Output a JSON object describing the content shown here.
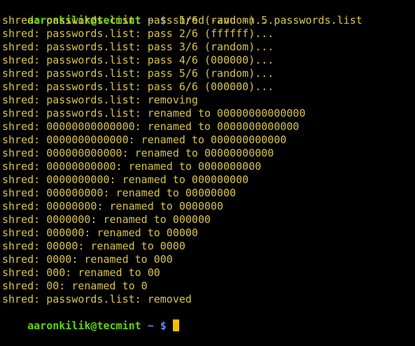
{
  "colors": {
    "background": "#000000",
    "output_text": "#d7c34b",
    "prompt_user": "#5fd700",
    "prompt_path": "#5f87ff",
    "cursor": "#f0c000"
  },
  "prompt": {
    "user_host": "aaronkilik@tecmint",
    "path": "~",
    "symbol": "$"
  },
  "command": "shred -zvu -n 5 passwords.list",
  "output_lines": [
    "shred: passwords.list: pass 1/6 (random)...",
    "shred: passwords.list: pass 2/6 (ffffff)...",
    "shred: passwords.list: pass 3/6 (random)...",
    "shred: passwords.list: pass 4/6 (000000)...",
    "shred: passwords.list: pass 5/6 (random)...",
    "shred: passwords.list: pass 6/6 (000000)...",
    "shred: passwords.list: removing",
    "shred: passwords.list: renamed to 00000000000000",
    "shred: 00000000000000: renamed to 0000000000000",
    "shred: 0000000000000: renamed to 000000000000",
    "shred: 000000000000: renamed to 00000000000",
    "shred: 00000000000: renamed to 0000000000",
    "shred: 0000000000: renamed to 000000000",
    "shred: 000000000: renamed to 00000000",
    "shred: 00000000: renamed to 0000000",
    "shred: 0000000: renamed to 000000",
    "shred: 000000: renamed to 00000",
    "shred: 00000: renamed to 0000",
    "shred: 0000: renamed to 000",
    "shred: 000: renamed to 00",
    "shred: 00: renamed to 0",
    "shred: passwords.list: removed"
  ]
}
